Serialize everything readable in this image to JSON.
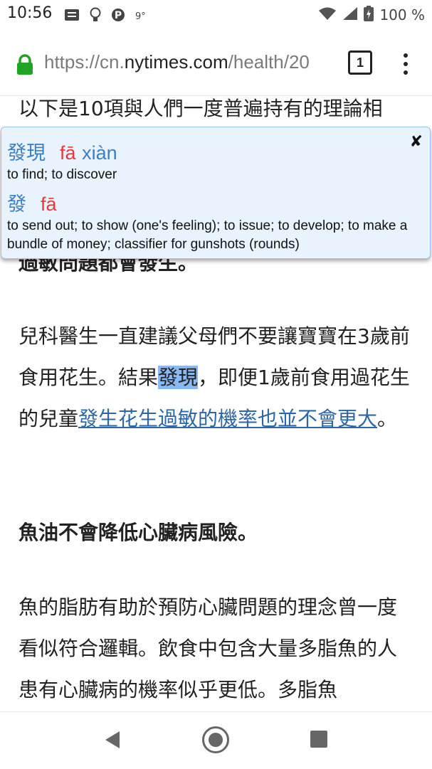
{
  "status_bar": {
    "time": "10:56",
    "icons": [
      "message-icon",
      "lightbulb-icon",
      "p-icon",
      "temperature-icon"
    ],
    "temp": "9°",
    "battery": "100 %"
  },
  "browser": {
    "url_prefix": "https://cn.",
    "url_domain": "nytimes.com",
    "url_rest": "/health/20",
    "tab_count": "1"
  },
  "article": {
    "line_top": "以下是10項與人們一度普遍持有的理論相",
    "line_hidden": "過敏問題都會發生。",
    "para2_before": "兒科醫生一直建議父母們不要讓寶寶在3歲前食用花生。結果",
    "para2_highlight": "發現",
    "para2_middle": "，即便1歲前食用過花生的兒童",
    "para2_link": "發生花生過敏的機率也並不會更大",
    "para2_after": "。",
    "heading": "魚油不會降低心臟病風險。",
    "para3": "魚的脂肪有助於預防心臟問題的理念曾一度看似符合邏輯。飲食中包含大量多脂魚的人患有心臟病的機率似乎更低。多脂魚"
  },
  "popup": {
    "close": "x",
    "entries": [
      {
        "word": "發現",
        "pinyin1": "fā",
        "pinyin2": "xiàn",
        "definition": "to find; to discover"
      },
      {
        "word": "發",
        "pinyin1": "fā",
        "pinyin2": "",
        "definition": "to send out; to show (one's feeling); to issue; to develop; to make a bundle of money; classifier for gunshots (rounds)"
      }
    ]
  },
  "nav": {
    "back": "back-icon",
    "home": "home-icon",
    "recent": "recents-icon"
  },
  "colors": {
    "link": "#2b66a8",
    "highlight": "#8ab8f0",
    "popup_bg": "#e8f3fd",
    "pinyin_red": "#e23b3b",
    "lock_green": "#21a324"
  }
}
